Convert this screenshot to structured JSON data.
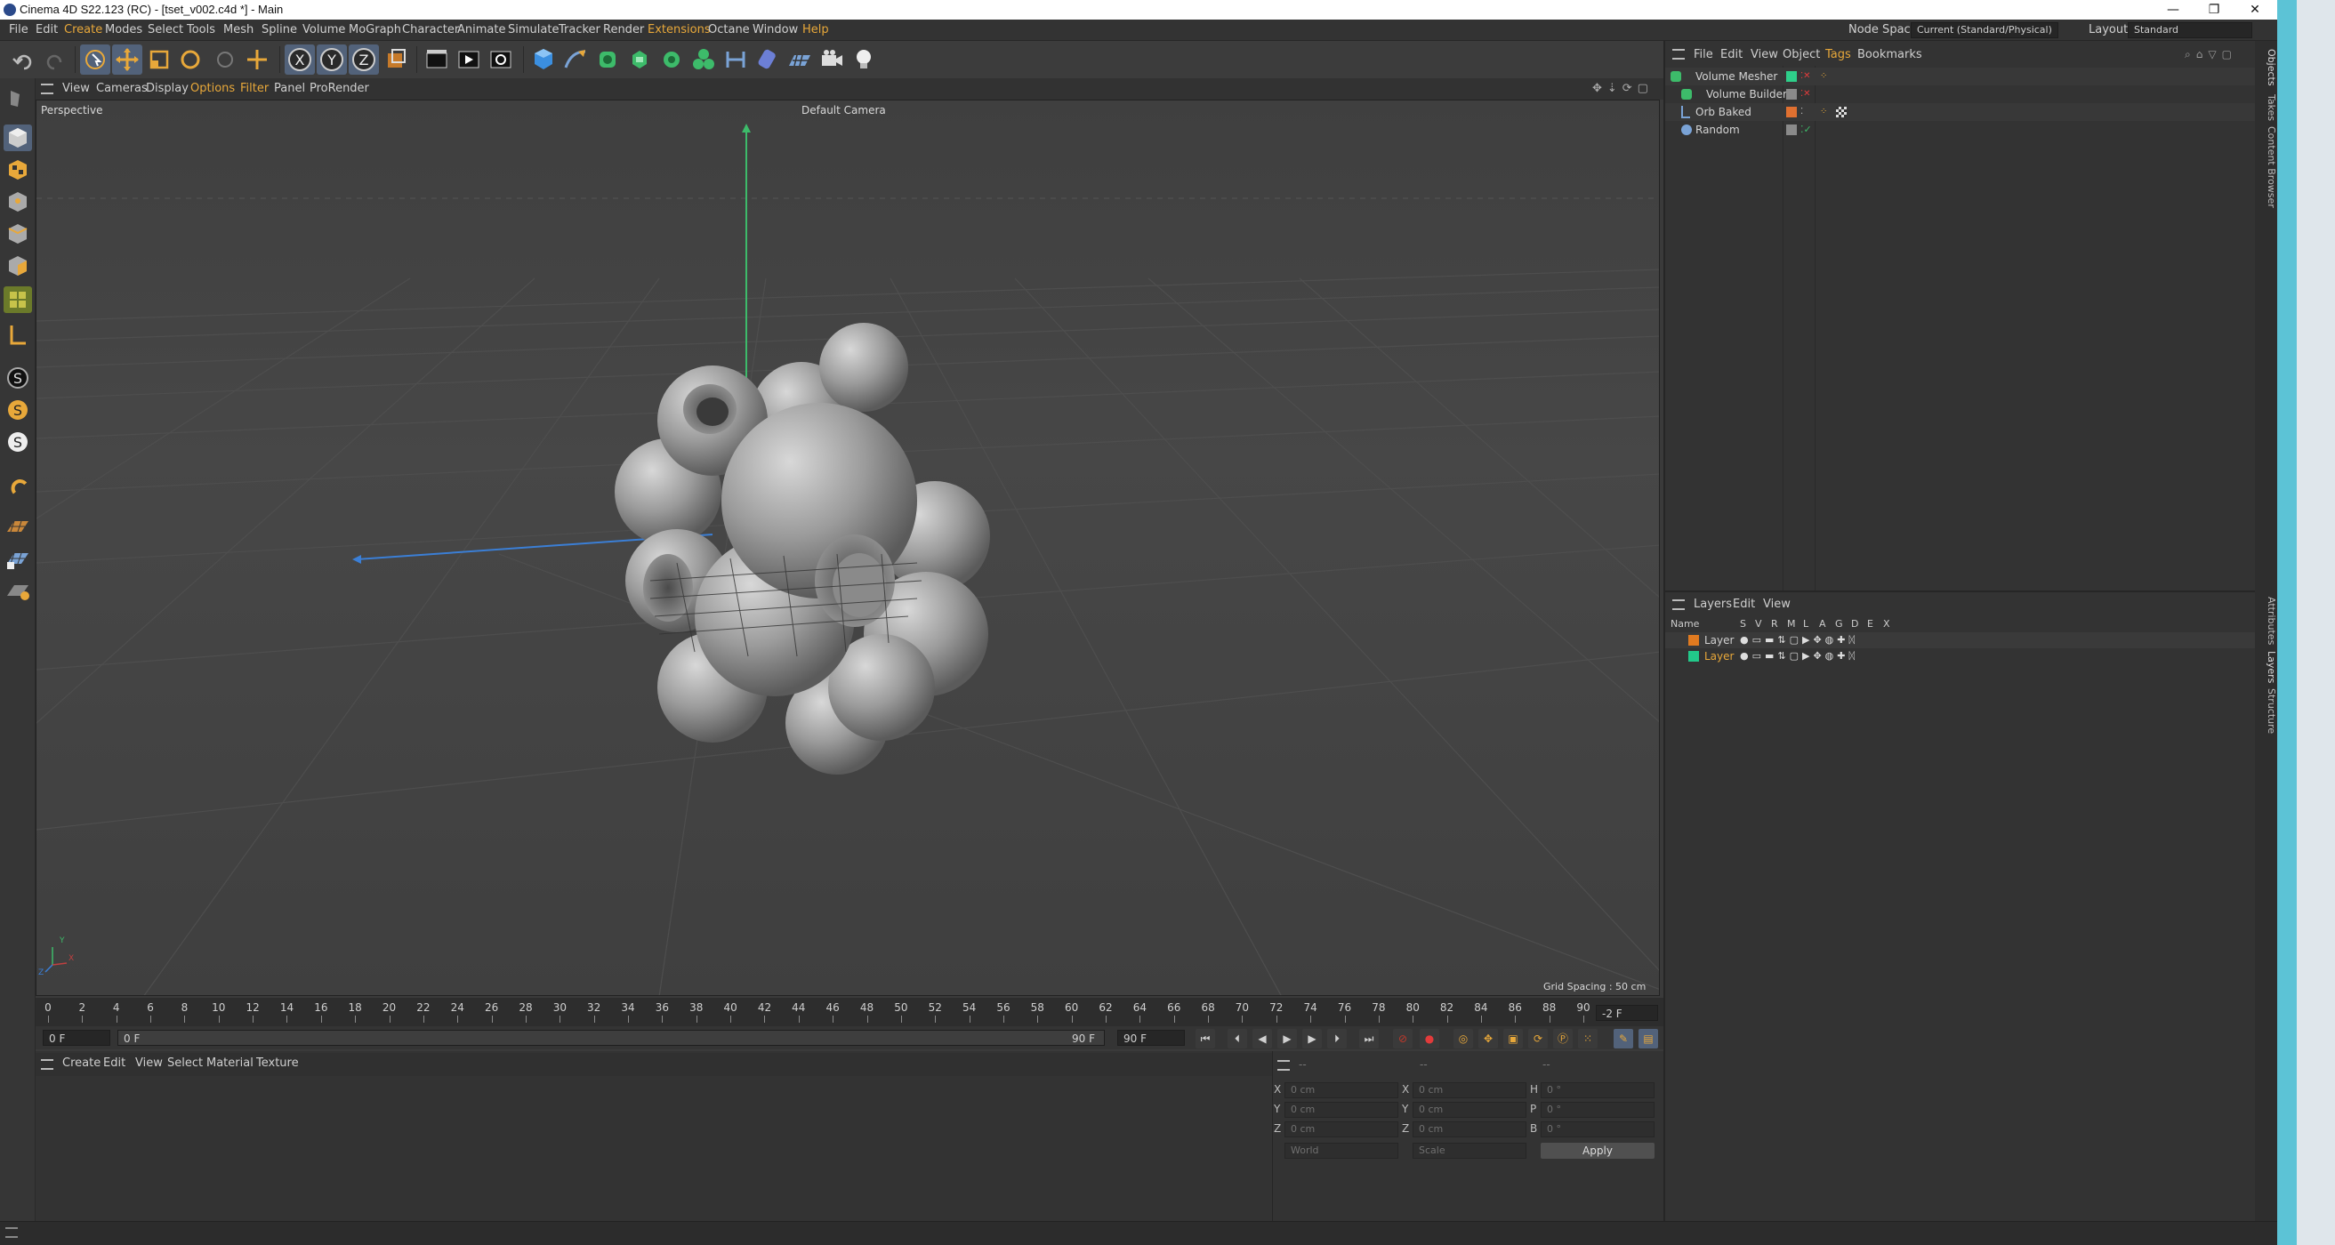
{
  "window": {
    "title": "Cinema 4D S22.123 (RC) - [tset_v002.c4d *] - Main",
    "controls": [
      "—",
      "❐",
      "✕"
    ]
  },
  "menubar": {
    "items": [
      "File",
      "Edit",
      "Create",
      "Modes",
      "Select",
      "Tools",
      "Mesh",
      "Spline",
      "Volume",
      "MoGraph",
      "Character",
      "Animate",
      "Simulate",
      "Tracker",
      "Render",
      "Extensions",
      "Octane",
      "Window",
      "Help"
    ],
    "node_space_label": "Node Space:",
    "node_space_value": "Current (Standard/Physical)",
    "layout_label": "Layout:",
    "layout_value": "Standard"
  },
  "viewport": {
    "menu": [
      "View",
      "Cameras",
      "Display",
      "Options",
      "Filter",
      "Panel",
      "ProRender"
    ],
    "view_name": "Perspective",
    "camera": "Default Camera",
    "grid_spacing": "Grid Spacing : 50 cm",
    "axis_y": "Y",
    "axis_x": "X",
    "axis_z": "Z"
  },
  "timeline": {
    "ticks": [
      "0",
      "2",
      "4",
      "6",
      "8",
      "10",
      "12",
      "14",
      "16",
      "18",
      "20",
      "22",
      "24",
      "26",
      "28",
      "30",
      "32",
      "34",
      "36",
      "38",
      "40",
      "42",
      "44",
      "46",
      "48",
      "50",
      "52",
      "54",
      "56",
      "58",
      "60",
      "62",
      "64",
      "66",
      "68",
      "70",
      "72",
      "74",
      "76",
      "78",
      "80",
      "82",
      "84",
      "86",
      "88",
      "90"
    ],
    "current_frame": "-2 F",
    "start_field": "0 F",
    "min_field": "0 F",
    "max_field": "90 F",
    "end_field": "90 F"
  },
  "material_manager": {
    "menu": [
      "Create",
      "Edit",
      "View",
      "Select",
      "Material",
      "Texture"
    ]
  },
  "coordinates": {
    "header": [
      "--",
      "--",
      "--"
    ],
    "rows": [
      {
        "a_label": "X",
        "a_value": "0 cm",
        "b_label": "X",
        "b_value": "0 cm",
        "c_label": "H",
        "c_value": "0 °"
      },
      {
        "a_label": "Y",
        "a_value": "0 cm",
        "b_label": "Y",
        "b_value": "0 cm",
        "c_label": "P",
        "c_value": "0 °"
      },
      {
        "a_label": "Z",
        "a_value": "0 cm",
        "b_label": "Z",
        "b_value": "0 cm",
        "c_label": "B",
        "c_value": "0 °"
      }
    ],
    "world_select": "World",
    "scale_select": "Scale",
    "apply_label": "Apply"
  },
  "object_manager": {
    "menu": [
      "File",
      "Edit",
      "View",
      "Object",
      "Tags",
      "Bookmarks"
    ],
    "objects": [
      {
        "name": "Volume Mesher",
        "color": "#2ecf8a"
      },
      {
        "name": "Volume Builder",
        "color": "#2ecf8a"
      },
      {
        "name": "Orb Baked",
        "color": "#e07030"
      },
      {
        "name": "Random",
        "color": "#d0d0d0"
      }
    ]
  },
  "layer_manager": {
    "menu": [
      "Layers",
      "Edit",
      "View"
    ],
    "columns": [
      "Name",
      "S",
      "V",
      "R",
      "M",
      "L",
      "A",
      "G",
      "D",
      "E",
      "X"
    ],
    "layers": [
      {
        "name": "Layer",
        "color": "#e07a20"
      },
      {
        "name": "Layer",
        "color": "#22c98a"
      }
    ]
  },
  "side_tabs": [
    "Objects",
    "Takes",
    "Content Browser",
    "Attributes",
    "Layers",
    "Structure"
  ],
  "colors": {
    "accent": "#e8a83a",
    "axis_y": "#3dbb6a",
    "axis_x": "#3b7fd6",
    "teal_strip": "#5cc3d6"
  }
}
